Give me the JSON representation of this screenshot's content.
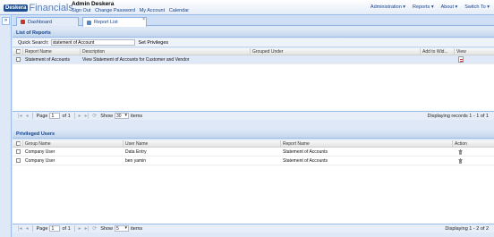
{
  "app": {
    "logo_mark": "Deskera",
    "logo_text": "Financials",
    "user_name": "Admin Deskera",
    "user_links": [
      "Sign Out",
      "Change Password",
      "My Account",
      "Calendar"
    ],
    "menus": [
      "Administration ▾",
      "Reports ▾",
      "About ▾",
      "Switch To ▾"
    ]
  },
  "tabs": [
    {
      "label": "Dashboard",
      "icon_color": "#c0392b"
    },
    {
      "label": "Report List",
      "icon_color": "#5a88c6",
      "close": "×"
    }
  ],
  "reports_panel": {
    "title": "List of Reports",
    "search_label": "Quick Search:",
    "search_value": "statement of Account",
    "set_privileges": "Set Privileges",
    "columns": [
      "Report Name",
      "Description",
      "Grouped Under",
      "Add to Wid...",
      "View"
    ],
    "rows": [
      {
        "checked": "✓",
        "name": "Statement of Accounts",
        "description": "View Statement of Accounts for Customer and Vendor",
        "grouped": "",
        "widget": ""
      }
    ],
    "pager": {
      "page_label": "Page",
      "page": "1",
      "of": "of 1",
      "show": "Show",
      "size": "30",
      "items": "items",
      "display": "Displaying records 1 - 1 of 1"
    }
  },
  "users_panel": {
    "title": "Privileged Users",
    "columns": [
      "Group Name",
      "User Name",
      "Report Name",
      "Action"
    ],
    "rows": [
      {
        "group": "Company User",
        "user": "Data Entry",
        "report": "Statement of Accounts"
      },
      {
        "group": "Company User",
        "user": "ben yamin",
        "report": "Statement of Accounts"
      }
    ],
    "pager": {
      "page_label": "Page",
      "page": "1",
      "of": "of 1",
      "show": "Show",
      "size": "5",
      "items": "items",
      "display": "Displaying 1 - 2 of 2"
    }
  }
}
